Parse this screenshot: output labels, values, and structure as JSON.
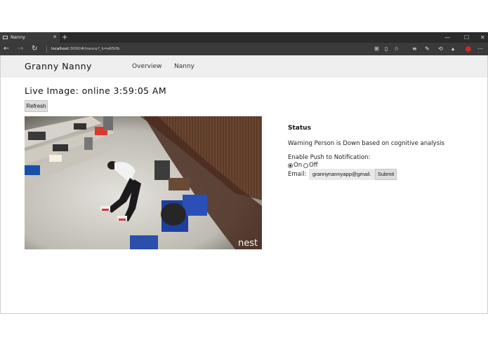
{
  "browser": {
    "tab_title": "Nanny",
    "tab_close": "✕",
    "new_tab": "+",
    "window_controls": [
      "—",
      "☐",
      "✕"
    ],
    "url_host": "localhost",
    "url_path": ":3000/#/nanny?_k=e65tfb"
  },
  "app": {
    "brand": "Granny Nanny",
    "nav": [
      "Overview",
      "Nanny"
    ]
  },
  "main": {
    "heading": "Live Image: online 3:59:05 AM",
    "refresh_label": "Refresh",
    "camera_watermark": "nest"
  },
  "status": {
    "title": "Status",
    "message": "Warning Person is Down based on cognitive analysis",
    "push_label": "Enable Push to Notification:",
    "radio_on": "On",
    "radio_off": "Off",
    "push_enabled": true,
    "email_label": "Email:",
    "email_value": "grannynannyapp@gmail.",
    "submit_label": "Submit"
  }
}
